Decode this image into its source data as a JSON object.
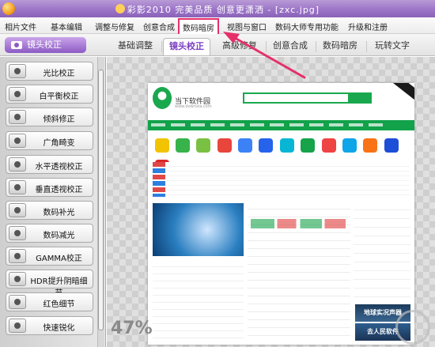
{
  "window": {
    "title": "彩影2010  完美品质  创意更潇洒 - [zxc.jpg]"
  },
  "menu": {
    "items": [
      {
        "label": "相片文件"
      },
      {
        "label": "基本编辑"
      },
      {
        "label": "调整与修复"
      },
      {
        "label": "创意合成"
      },
      {
        "label": "数码暗房",
        "highlighted": true
      },
      {
        "label": "视图与窗口"
      },
      {
        "label": "数码大师专用功能"
      },
      {
        "label": "升级和注册"
      }
    ]
  },
  "toolbar": {
    "lens_button": "镜头校正",
    "tabs": [
      {
        "label": "基础调整"
      },
      {
        "label": "镜头校正",
        "active": true
      },
      {
        "label": "高级修复"
      },
      {
        "label": "创意合成"
      },
      {
        "label": "数码暗房"
      },
      {
        "label": "玩转文字"
      }
    ]
  },
  "sidebar": {
    "buttons": [
      {
        "label": "光比校正",
        "icon": "light-ratio-icon"
      },
      {
        "label": "白平衡校正",
        "icon": "white-balance-icon"
      },
      {
        "label": "倾斜修正",
        "icon": "tilt-icon"
      },
      {
        "label": "广角畸变",
        "icon": "wide-angle-icon"
      },
      {
        "label": "水平透视校正",
        "icon": "horizontal-perspective-icon"
      },
      {
        "label": "垂直透视校正",
        "icon": "vertical-perspective-icon"
      },
      {
        "label": "数码补光",
        "icon": "fill-light-icon"
      },
      {
        "label": "数码减光",
        "icon": "reduce-light-icon"
      },
      {
        "label": "GAMMA校正",
        "icon": "gamma-icon"
      },
      {
        "label": "HDR提升阴暗细节",
        "icon": "hdr-icon"
      },
      {
        "label": "红色细节",
        "icon": "red-detail-icon"
      },
      {
        "label": "快速锐化",
        "icon": "sharpen-icon"
      }
    ]
  },
  "canvas": {
    "zoom": "47%"
  },
  "photo": {
    "site_name": "当下软件园",
    "site_url": "www.downxia.com",
    "ad1": "地球实况声器",
    "ad2": "去人民软件"
  },
  "colors": {
    "accent": "#8c5bc4",
    "highlight_box": "#e5306a",
    "arrow": "#e5306a",
    "site_green": "#12a24a"
  }
}
